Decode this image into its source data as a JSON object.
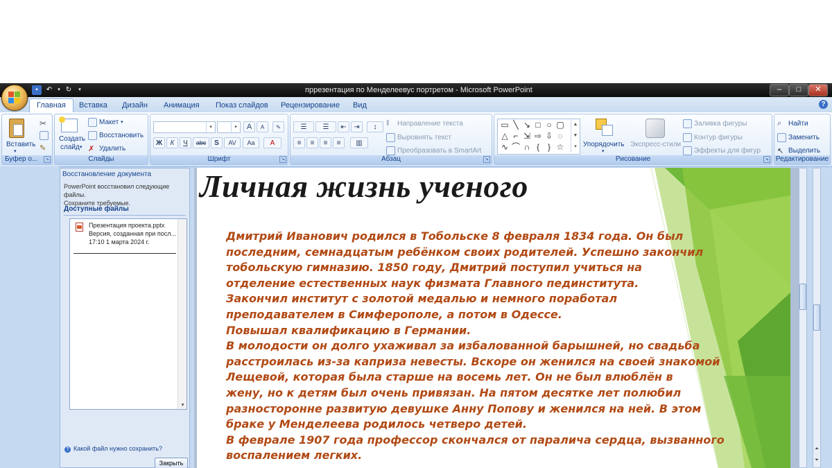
{
  "window": {
    "title": "пpрезентация по Менделеевус портретом - Microsoft PowerPoint",
    "controls": {
      "minimize": "–",
      "maximize": "□",
      "close": "✕"
    }
  },
  "colors": {
    "ribbon_text": "#15428b",
    "slide_body_text": "#b14a15",
    "slide_title_text": "#1a1a1a",
    "accent_green": "#8cc63f"
  },
  "tabs": [
    "Главная",
    "Вставка",
    "Дизайн",
    "Анимация",
    "Показ слайдов",
    "Рецензирование",
    "Вид"
  ],
  "ribbon": {
    "clipboard": {
      "title": "Буфер о...",
      "paste": "Вставить"
    },
    "slides": {
      "title": "Слайды",
      "create_1": "Создать",
      "create_2": "слайд",
      "layout": "Макет",
      "reset": "Восстановить",
      "delete": "Удалить"
    },
    "font": {
      "title": "Шрифт",
      "bold": "Ж",
      "italic": "К",
      "underline": "Ч",
      "strike": "abc",
      "shadow": "S",
      "spacing": "AV",
      "case": "Aa",
      "color": "A",
      "grow": "A",
      "shrink": "A"
    },
    "paragraph": {
      "title": "Абзац",
      "text_direction": "Направление текста",
      "align_text": "Выровнять текст",
      "smartart": "Преобразовать в SmartArt"
    },
    "drawing": {
      "title": "Рисование",
      "arrange": "Упорядочить",
      "quick_styles": "Экспресс-стили",
      "fill": "Заливка фигуры",
      "outline": "Контур фигуры",
      "effects": "Эффекты для фигур"
    },
    "editing": {
      "title": "Редактирование",
      "find": "Найти",
      "replace": "Заменить",
      "select": "Выделить"
    }
  },
  "recovery": {
    "title": "Восстановление документа",
    "message_1": "PowerPoint восстановил следующие файлы.",
    "message_2": "Сохраните требуемые.",
    "available": "Доступные файлы",
    "file_name": "Презентация проекта.pptx",
    "file_menu": "...",
    "file_desc": "Версия, созданная при посл...",
    "file_time": "17:10 1 марта 2024 г.",
    "question": "Какой файл нужно сохранить?",
    "close": "Закрыть"
  },
  "slide": {
    "title": "Личная жизнь ученого",
    "lines": [
      "Дмитрий Иванович родился в Тобольске 8 февраля 1834 года. Он был",
      "последним, семнадцатым ребёнком своих родителей.  Успешно закончил",
      "тобольскую гимназию. 1850 году, Дмитрий поступил учиться на",
      "отделение естественных наук физмата Главного пединститута.",
      "Закончил институт с золотой медалью и немного поработал",
      "преподавателем в  Симферополе, а потом в Одессе.",
      "Повышал квалификацию в Германии.",
      "В молодости он долго ухаживал за избалованной барышней, но свадьба",
      "расстроилась из-за каприза невесты. Вскоре он женился на своей знакомой",
      "Лещевой, которая  была старше на восемь лет. Он не был влюблён в",
      "жену, но к детям был очень привязан. На пятом десятке лет  полюбил",
      "разносторонне развитую девушке Анну Попову и женился на ней. В этом",
      "браке у Менделеева родилось четверо детей.",
      "В феврале 1907 года профессор скончался от паралича сердца, вызванного",
      "воспалением легких."
    ]
  }
}
